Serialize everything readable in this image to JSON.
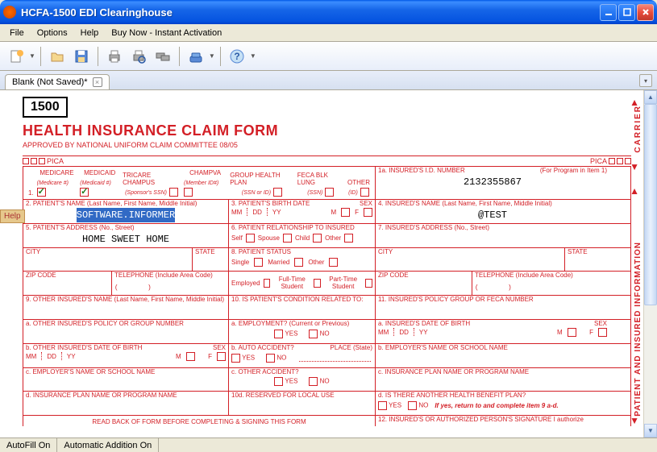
{
  "window": {
    "title": "HCFA-1500 EDI Clearinghouse"
  },
  "menu": {
    "file": "File",
    "options": "Options",
    "help": "Help",
    "buynow": "Buy Now - Instant Activation"
  },
  "tab": {
    "label": "Blank (Not Saved)*"
  },
  "help_tab": "Help",
  "form": {
    "box1500": "1500",
    "title": "HEALTH INSURANCE CLAIM FORM",
    "subtitle": "APPROVED BY NATIONAL UNIFORM CLAIM COMMITTEE 08/05",
    "pica": "PICA",
    "carrier": "CARRIER",
    "patient_info": "PATIENT AND INSURED INFORMATION"
  },
  "row1": {
    "num": "1.",
    "medicare": "MEDICARE",
    "medicare_sub": "(Medicare #)",
    "medicaid": "MEDICAID",
    "medicaid_sub": "(Medicaid #)",
    "tricare": "TRICARE CHAMPUS",
    "tricare_sub": "(Sponsor's SSN)",
    "champva": "CHAMPVA",
    "champva_sub": "(Member ID#)",
    "group": "GROUP HEALTH PLAN",
    "group_sub": "(SSN or ID)",
    "feca": "FECA BLK LUNG",
    "feca_sub": "(SSN)",
    "other": "OTHER",
    "other_sub": "(ID)",
    "ia_label": "1a. INSURED'S I.D. NUMBER",
    "ia_program": "(For Program in Item 1)",
    "ia_value": "2132355867"
  },
  "row2": {
    "label": "2. PATIENT'S NAME (Last Name, First Name, Middle Initial)",
    "value": "SOFTWARE.INFORMER",
    "birth_label": "3. PATIENT'S BIRTH DATE",
    "mm": "MM",
    "dd": "DD",
    "yy": "YY",
    "sex": "SEX",
    "m": "M",
    "f": "F",
    "insured_label": "4. INSURED'S NAME (Last Name, First Name, Middle Initial)",
    "insured_value": "@TEST"
  },
  "row5": {
    "label": "5. PATIENT'S ADDRESS (No., Street)",
    "value": "HOME SWEET HOME",
    "rel_label": "6. PATIENT RELATIONSHIP TO INSURED",
    "self": "Self",
    "spouse": "Spouse",
    "child": "Child",
    "other": "Other",
    "insured_addr": "7. INSURED'S ADDRESS (No., Street)"
  },
  "city": {
    "city": "CITY",
    "state": "STATE",
    "status_label": "8. PATIENT STATUS",
    "single": "Single",
    "married": "Married",
    "other": "Other",
    "employed": "Employed",
    "ftstudent": "Full-Time Student",
    "ptstudent": "Part-Time Student"
  },
  "zip": {
    "zip": "ZIP CODE",
    "tel": "TELEPHONE (Include Area Code)",
    "paren_open": "(",
    "paren_close": ")"
  },
  "row9": {
    "label": "9. OTHER INSURED'S NAME (Last Name, First Name, Middle Initial)",
    "cond_label": "10. IS PATIENT'S CONDITION RELATED TO:",
    "policy_label": "11. INSURED'S POLICY GROUP OR FECA NUMBER"
  },
  "row9a": {
    "label": "a. OTHER INSURED'S POLICY OR GROUP NUMBER",
    "emp_label": "a. EMPLOYMENT? (Current or Previous)",
    "yes": "YES",
    "no": "NO",
    "dob_label": "a. INSURED'S DATE OF BIRTH"
  },
  "row9b": {
    "label": "b. OTHER INSURED'S DATE OF BIRTH",
    "auto_label": "b. AUTO ACCIDENT?",
    "place": "PLACE (State)",
    "emp_label": "b. EMPLOYER'S NAME OR SCHOOL NAME"
  },
  "row9c": {
    "label": "c. EMPLOYER'S NAME OR SCHOOL NAME",
    "other_acc": "c. OTHER ACCIDENT?",
    "plan_label": "c. INSURANCE PLAN NAME OR PROGRAM NAME"
  },
  "row9d": {
    "label": "d. INSURANCE PLAN NAME OR PROGRAM NAME",
    "reserved": "10d. RESERVED FOR LOCAL USE",
    "benefit_label": "d. IS THERE ANOTHER HEALTH BENEFIT PLAN?",
    "ifyes": "If yes, return to and complete item 9 a-d."
  },
  "backtext": "READ BACK OF FORM BEFORE COMPLETING & SIGNING THIS FORM",
  "row12": "12. INSURED'S OR AUTHORIZED PERSON'S SIGNATURE I authorize",
  "status": {
    "autofill": "AutoFill On",
    "autoadd": "Automatic Addition On"
  }
}
